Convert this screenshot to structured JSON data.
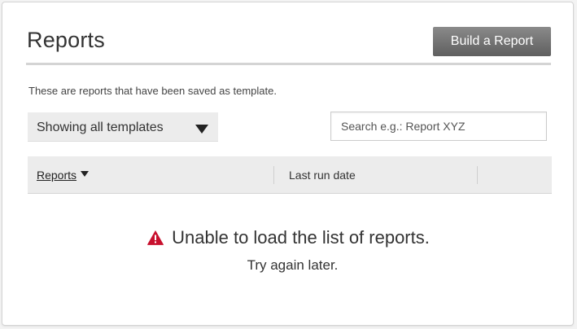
{
  "header": {
    "title": "Reports",
    "build_button_label": "Build a Report"
  },
  "subtitle": "These are reports that have been saved as template.",
  "filter": {
    "selected": "Showing all templates"
  },
  "search": {
    "placeholder": "Search e.g.: Report XYZ",
    "value": ""
  },
  "table": {
    "columns": [
      {
        "label": "Reports",
        "sortable": true,
        "sort": "descending"
      },
      {
        "label": "Last run date"
      }
    ]
  },
  "error": {
    "message": "Unable to load the list of reports.",
    "hint": "Try again later.",
    "icon": "warning-icon",
    "icon_color": "#c8102e"
  },
  "colors": {
    "button_gradient_top": "#8a8a8a",
    "button_gradient_bottom": "#5f5f5f",
    "header_bg": "#ececec"
  }
}
